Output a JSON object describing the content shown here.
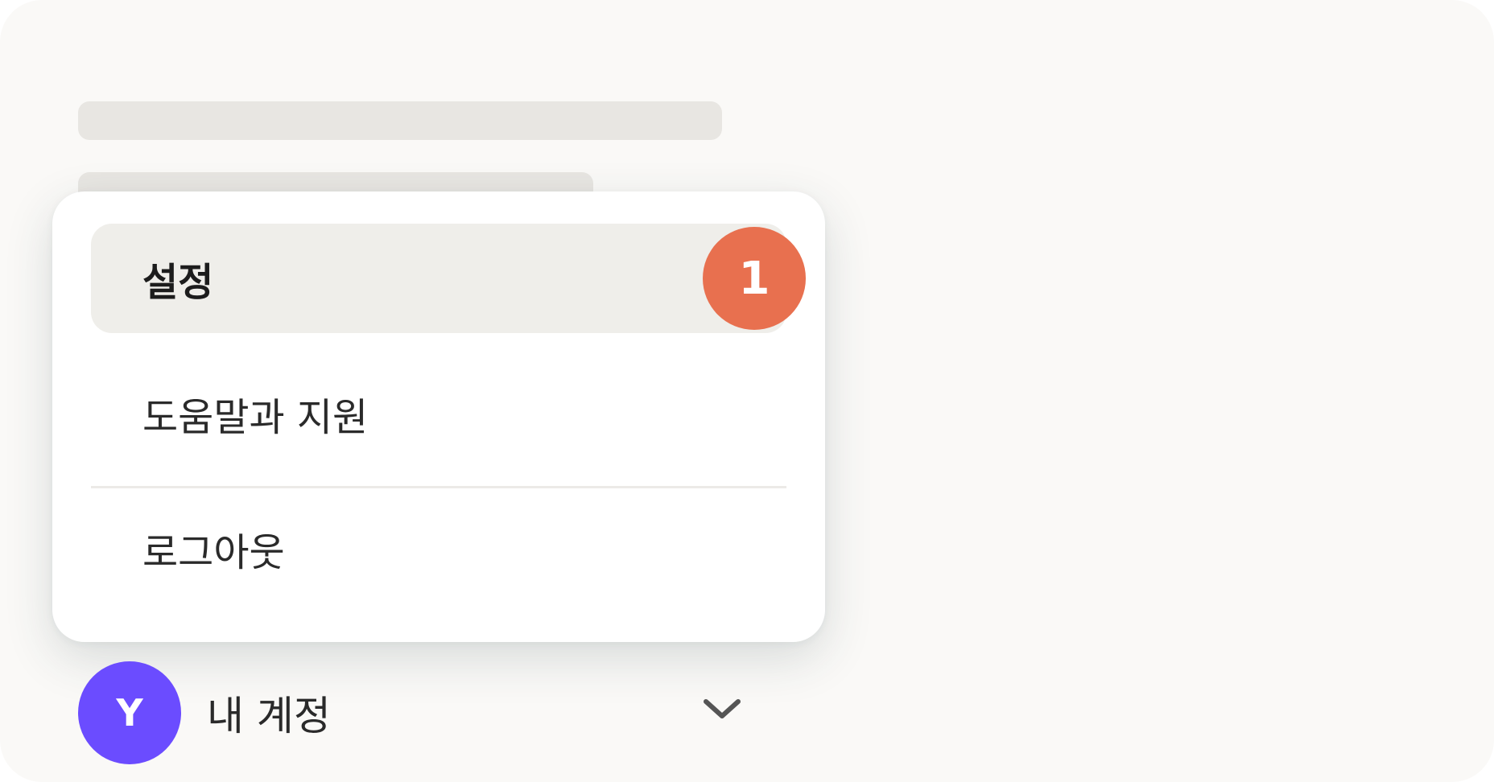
{
  "menu": {
    "items": [
      {
        "label": "설정",
        "badge": "1",
        "highlighted": true
      },
      {
        "label": "도움말과 지원"
      },
      {
        "label": "로그아웃"
      }
    ]
  },
  "account": {
    "avatar_initial": "Y",
    "name": "내 계정",
    "chevron_icon": "chevron-down-icon"
  },
  "colors": {
    "badge": "#e8704f",
    "avatar": "#6b4cff",
    "highlight": "#efeeea",
    "panel_bg": "#faf9f7",
    "skeleton": "#e8e6e2"
  }
}
